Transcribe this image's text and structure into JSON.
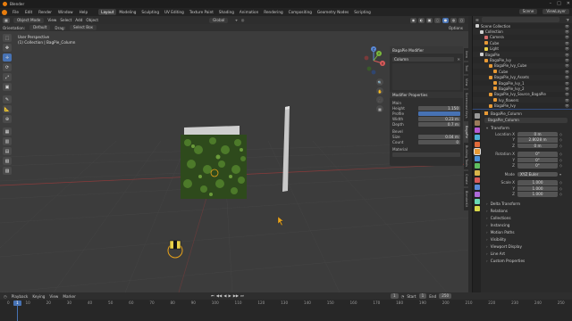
{
  "titlebar": {
    "app": "Blender",
    "controls": [
      "–",
      "□",
      "✕"
    ]
  },
  "menubar": {
    "menus": [
      "File",
      "Edit",
      "Render",
      "Window",
      "Help"
    ],
    "workspaces": [
      "Layout",
      "Modeling",
      "Sculpting",
      "UV Editing",
      "Texture Paint",
      "Shading",
      "Animation",
      "Rendering",
      "Compositing",
      "Geometry Nodes",
      "Scripting"
    ],
    "active_workspace": "Layout",
    "scene": "Scene",
    "view_layer": "ViewLayer"
  },
  "viewport": {
    "mode": "Object Mode",
    "header_menus": [
      "View",
      "Select",
      "Add",
      "Object"
    ],
    "orientation_label": "Orientation:",
    "orientation": "Default",
    "drag_label": "Drag:",
    "drag": "Select Box",
    "transform": "Global",
    "options": "Options",
    "info_line1": "User Perspective",
    "info_line2": "(1) Collection | BagPie_Column",
    "toolbar": [
      "⬚",
      "✥",
      "✛",
      "⟳",
      "⤢",
      "▣",
      "✎",
      "📐",
      "⊕",
      "▦",
      "▥",
      "▤",
      "▧",
      "▨"
    ],
    "nav_buttons": [
      "🔍",
      "✋",
      "🎥",
      "▦"
    ],
    "gizmo": {
      "x": "X",
      "y": "Y",
      "z": "Z"
    }
  },
  "npanel": {
    "title": "BagaPie Modifier",
    "object": "Column",
    "section_props": "Modifier Properties",
    "main_label": "Main",
    "height_label": "Height",
    "height": "1.150",
    "profile_label": "Profile",
    "width_label": "Width",
    "width": "0.23 m",
    "depth_label": "Depth",
    "depth": "0.7 m",
    "bevel_label": "Bevel",
    "size_label": "Size",
    "size": "0.04 m",
    "count_label": "Count",
    "count": "0",
    "material_label": "Material",
    "tabs": [
      "Item",
      "Tool",
      "View",
      "Screencast Keys",
      "BagaPie",
      "Building Tools",
      "Create",
      "BlenderKit"
    ],
    "active_tab": "BagaPie"
  },
  "outliner": {
    "header": "Scene Collection",
    "rows": [
      {
        "name": "Scene Collection",
        "indent": 0,
        "color": "#cfcfcf"
      },
      {
        "name": "Collection",
        "indent": 1,
        "color": "#cfcfcf"
      },
      {
        "name": "Camera",
        "indent": 2,
        "color": "#d46b6b"
      },
      {
        "name": "Cube",
        "indent": 2,
        "color": "#e89a35"
      },
      {
        "name": "Light",
        "indent": 2,
        "color": "#e8d048"
      },
      {
        "name": "BagaPie",
        "indent": 1,
        "color": "#cfcfcf"
      },
      {
        "name": "BagaPie_Ivy",
        "indent": 2,
        "color": "#e89a35"
      },
      {
        "name": "BagaPie_Ivy_Cube",
        "indent": 3,
        "color": "#e89a35"
      },
      {
        "name": "Cube",
        "indent": 4,
        "color": "#e89a35"
      },
      {
        "name": "BagaPie_Ivy_Assets",
        "indent": 3,
        "color": "#e89a35"
      },
      {
        "name": "BagaPie_Ivy_1",
        "indent": 4,
        "color": "#e89a35"
      },
      {
        "name": "BagaPie_Ivy_2",
        "indent": 4,
        "color": "#e89a35"
      },
      {
        "name": "BagaPie_Ivy_Source_BagaPie",
        "indent": 3,
        "color": "#e89a35"
      },
      {
        "name": "Ivy_flowers",
        "indent": 4,
        "color": "#e89a35"
      },
      {
        "name": "BagaPie_Ivy",
        "indent": 3,
        "color": "#e89a35"
      },
      {
        "name": "BagaPie_Column",
        "indent": 2,
        "color": "#e89a35",
        "selected": true
      }
    ]
  },
  "properties": {
    "object_name": "BagaPie_Column",
    "object_field": "BagaPie_Column",
    "sections": {
      "transform": "Transform"
    },
    "location_label": "Location X",
    "location": [
      "0 m",
      "2.8028 m",
      "0 m"
    ],
    "rotation_label": "Rotation X",
    "rotation": [
      "0°",
      "0°",
      "0°"
    ],
    "mode_label": "Mode",
    "mode": "XYZ Euler",
    "scale_label": "Scale X",
    "scale": [
      "1.000",
      "1.000",
      "1.000"
    ],
    "axis_y": "Y",
    "axis_z": "Z",
    "collapsed": [
      "Delta Transform",
      "Relations",
      "Collections",
      "Instancing",
      "Motion Paths",
      "Visibility",
      "Viewport Display",
      "Line Art",
      "Custom Properties"
    ],
    "tab_colors": [
      "#999999",
      "#9a7b5b",
      "#b55ad4",
      "#4db0d6",
      "#e06a3a",
      "#e89a35",
      "#4a8fd8",
      "#5fbf5f",
      "#d8b44a",
      "#d85a5a",
      "#5a8ad8",
      "#ad6ad8",
      "#6ad8b4",
      "#d8d84a"
    ]
  },
  "timeline": {
    "menus": [
      "Playback",
      "Keying",
      "View",
      "Marker"
    ],
    "current_frame": "1",
    "start_label": "Start",
    "start": "1",
    "end_label": "End",
    "end": "250",
    "ruler": [
      "0",
      "10",
      "20",
      "30",
      "40",
      "50",
      "60",
      "70",
      "80",
      "90",
      "100",
      "110",
      "120",
      "130",
      "140",
      "150",
      "160",
      "170",
      "180",
      "190",
      "200",
      "210",
      "220",
      "230",
      "240",
      "250"
    ],
    "controls": [
      "⏮",
      "◀◀",
      "◀",
      "▶",
      "▶▶",
      "⏭"
    ]
  }
}
